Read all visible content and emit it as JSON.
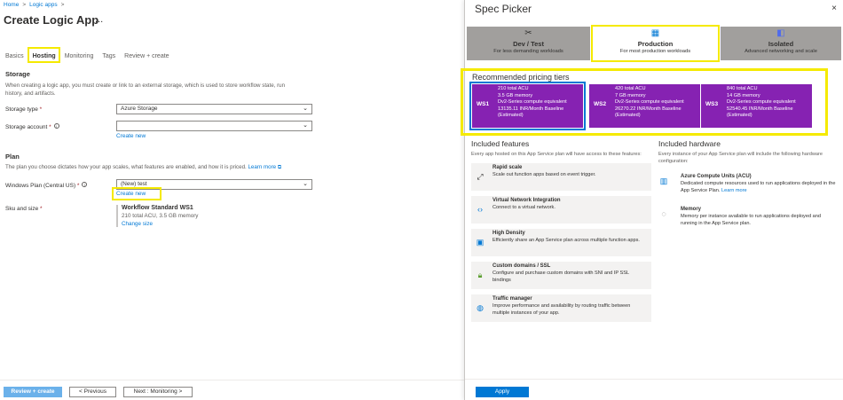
{
  "breadcrumb": {
    "home": "Home",
    "sep": ">",
    "logic_apps": "Logic apps"
  },
  "page": {
    "title": "Create Logic App",
    "more": "..."
  },
  "tabs": [
    "Basics",
    "Hosting",
    "Monitoring",
    "Tags",
    "Review + create"
  ],
  "storage": {
    "heading": "Storage",
    "desc_line1": "When creating a logic app, you must create or link to an external storage, which is used to store workflow state, run",
    "desc_line2": "history, and artifacts.",
    "type_label": "Storage type",
    "type_value": "Azure Storage",
    "account_label": "Storage account",
    "create_new": "Create new"
  },
  "plan": {
    "heading": "Plan",
    "desc": "The plan you choose dictates how your app scales, what features are enabled, and how it is priced.",
    "learn_more": "Learn more",
    "windows_label": "Windows Plan (Central US)",
    "windows_value": "(New) test",
    "create_new": "Create new",
    "sku_label": "Sku and size",
    "sku_title": "Workflow Standard WS1",
    "sku_detail": "210 total ACU, 3.5 GB memory",
    "change_size": "Change size"
  },
  "footer": {
    "review": "Review + create",
    "previous": "< Previous",
    "next": "Next : Monitoring >"
  },
  "spec": {
    "title": "Spec Picker",
    "close": "×",
    "workloads": [
      {
        "name": "Dev / Test",
        "sub": "For less demanding workloads",
        "icon": "wrench-icon"
      },
      {
        "name": "Production",
        "sub": "For most production workloads",
        "icon": "building-icon"
      },
      {
        "name": "Isolated",
        "sub": "Advanced networking and scale",
        "icon": "cube-icon"
      }
    ],
    "recommended_title": "Recommended pricing tiers",
    "tiers": [
      {
        "code": "WS1",
        "l1": "210 total ACU",
        "l2": "3.5 GB memory",
        "l3": "Dv2-Series compute equivalent",
        "l4": "13135.11 INR/Month Baseline",
        "l5": "(Estimated)"
      },
      {
        "code": "WS2",
        "l1": "420 total ACU",
        "l2": "7 GB memory",
        "l3": "Dv2-Series compute equivalent",
        "l4": "26270.22 INR/Month Baseline",
        "l5": "(Estimated)"
      },
      {
        "code": "WS3",
        "l1": "840 total ACU",
        "l2": "14 GB memory",
        "l3": "Dv2-Series compute equivalent",
        "l4": "52540.45 INR/Month Baseline",
        "l5": "(Estimated)"
      }
    ],
    "features_title": "Included features",
    "features_sub": "Every app hosted on this App Service plan will have access to these features:",
    "features": [
      {
        "title": "Rapid scale",
        "desc": "Scale out function apps based on event trigger."
      },
      {
        "title": "Virtual Network Integration",
        "desc": "Connect to a virtual network."
      },
      {
        "title": "High Density",
        "desc": "Efficiently share an App Service plan across multiple function apps."
      },
      {
        "title": "Custom domains / SSL",
        "desc": "Configure and purchase custom domains with SNI and IP SSL bindings"
      },
      {
        "title": "Traffic manager",
        "desc": "Improve performance and availability by routing traffic between multiple instances of your app."
      }
    ],
    "hardware_title": "Included hardware",
    "hardware_sub": "Every instance of your App Service plan will include the following hardware configuration:",
    "hardware": [
      {
        "title": "Azure Compute Units (ACU)",
        "desc": "Dedicated compute resources used to run applications deployed in the App Service Plan.",
        "link": "Learn more"
      },
      {
        "title": "Memory",
        "desc": "Memory per instance available to run applications deployed and running in the App Service plan."
      }
    ],
    "apply": "Apply"
  },
  "colors": {
    "accent": "#0078d4",
    "tier": "#8622b2",
    "highlight": "#f5ea00"
  }
}
